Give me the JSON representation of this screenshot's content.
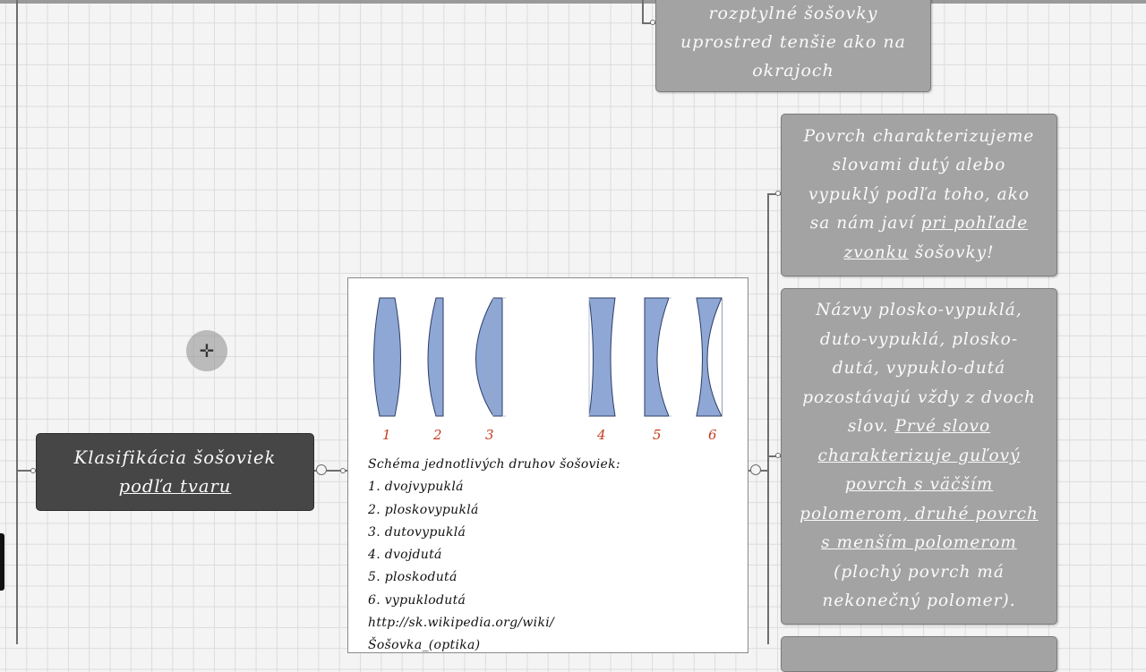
{
  "nodes": {
    "top_concave": [
      "rozptylné šošovky",
      "uprostred tenšie ako na",
      "okrajoch"
    ],
    "surface": {
      "lines": [
        "Povrch charakterizujeme",
        "slovami dutý alebo",
        "vypuklý podľa toho, ako"
      ],
      "line4_pre": "sa nám javí ",
      "line4_ul": "pri pohľade",
      "line5_ul": "zvonku",
      "line5_post": " šošovky!"
    },
    "names": {
      "lines": [
        "Názvy plosko-vypuklá,",
        "duto-vypuklá, plosko-",
        "dutá, vypuklo-dutá",
        "pozostávajú vždy z dvoch"
      ],
      "line5_pre": "slov. ",
      "line5_ul": "Prvé slovo",
      "ul_lines": [
        "charakterizuje guľový",
        "povrch s väčším",
        "polomerom, druhé povrch",
        "s menším polomerom"
      ],
      "tail_lines": [
        "(plochý povrch má",
        "nekonečný polomer)."
      ]
    },
    "classification": {
      "line1": "Klasifikácia šošoviek",
      "line2": "podľa tvaru"
    }
  },
  "card": {
    "numbers": [
      "1",
      "2",
      "3",
      "4",
      "5",
      "6"
    ],
    "caption": "Schéma jednotlivých druhov šošoviek:",
    "items": [
      "1. dvojvypuklá",
      "2. ploskovypuklá",
      "3. dutovypuklá",
      "4. dvojdutá",
      "5. ploskodutá",
      "6. vypuklodutá"
    ],
    "link": "http://sk.wikipedia.org/wiki/",
    "link2": "Šošovka_(optika)"
  },
  "colors": {
    "lens_fill": "#8fa7d4",
    "lens_stroke": "#2c3e66",
    "number": "#c43c1c",
    "node_gray": "#a3a3a3",
    "node_dark": "#464646"
  }
}
